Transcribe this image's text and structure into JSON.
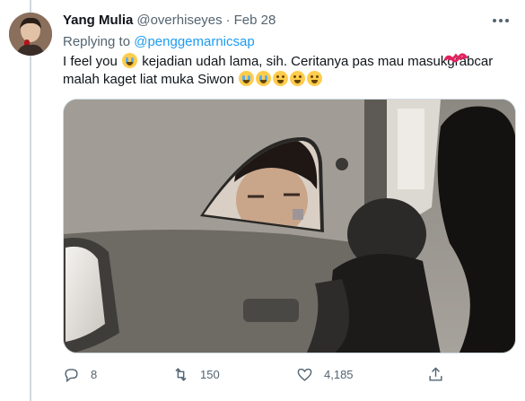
{
  "tweet": {
    "display_name": "Yang Mulia",
    "handle": "@overhiseyes",
    "separator": "·",
    "date": "Feb 28",
    "reply_prefix": "Replying to",
    "reply_to": "@penggemarnicsap",
    "text_part1": "I feel you",
    "text_part2": "kejadian udah lama, sih. Ceritanya pas mau masuk",
    "text_scribbled": "gra",
    "text_part3": "bcar malah kaget liat muka Siwon",
    "emojis": [
      "crying-face",
      "loudly-crying-face",
      "loudly-crying-face",
      "face-with-tears-of-joy",
      "face-with-tears-of-joy",
      "face-with-tears-of-joy"
    ]
  },
  "actions": {
    "reply_count": "8",
    "retweet_count": "150",
    "like_count": "4,185"
  },
  "colors": {
    "text": "#0f1419",
    "secondary": "#536471",
    "link": "#1d9bf0",
    "border": "#cfd9de"
  }
}
